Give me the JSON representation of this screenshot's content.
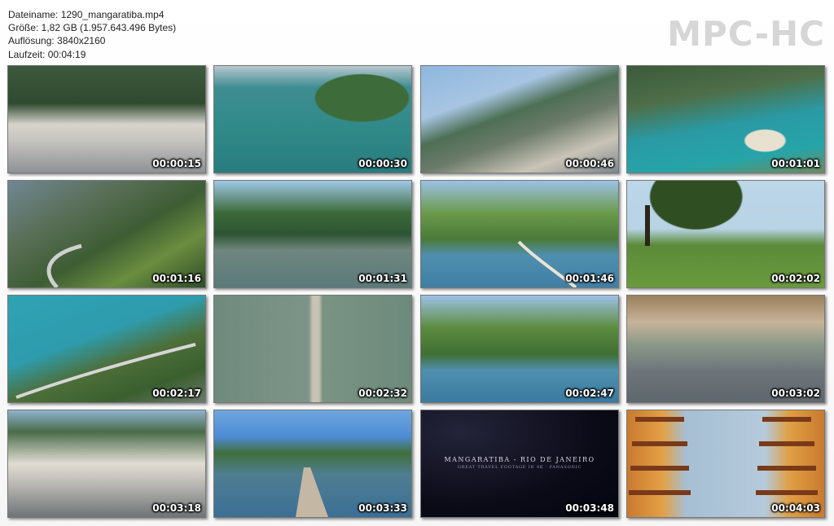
{
  "info": {
    "filename": "Dateiname: 1290_mangaratiba.mp4",
    "size": "Größe: 1,82 GB (1.957.643.496 Bytes)",
    "resolution": "Auflösung: 3840x2160",
    "duration": "Laufzeit: 00:04:19"
  },
  "logo": "MPC-HC",
  "thumbnails": [
    {
      "id": 1,
      "timestamp": "00:00:15"
    },
    {
      "id": 2,
      "timestamp": "00:00:30"
    },
    {
      "id": 3,
      "timestamp": "00:00:46"
    },
    {
      "id": 4,
      "timestamp": "00:01:01"
    },
    {
      "id": 5,
      "timestamp": "00:01:16"
    },
    {
      "id": 6,
      "timestamp": "00:01:31"
    },
    {
      "id": 7,
      "timestamp": "00:01:46"
    },
    {
      "id": 8,
      "timestamp": "00:02:02"
    },
    {
      "id": 9,
      "timestamp": "00:02:17"
    },
    {
      "id": 10,
      "timestamp": "00:02:32"
    },
    {
      "id": 11,
      "timestamp": "00:02:47"
    },
    {
      "id": 12,
      "timestamp": "00:03:02"
    },
    {
      "id": 13,
      "timestamp": "00:03:18"
    },
    {
      "id": 14,
      "timestamp": "00:03:33"
    },
    {
      "id": 15,
      "timestamp": "00:03:48",
      "title": "MANGARATIBA - RIO DE JANEIRO",
      "subtitle": "GREAT TRAVEL FOOTAGE IN 4K · PANASONIC"
    },
    {
      "id": 16,
      "timestamp": "00:04:03"
    }
  ]
}
